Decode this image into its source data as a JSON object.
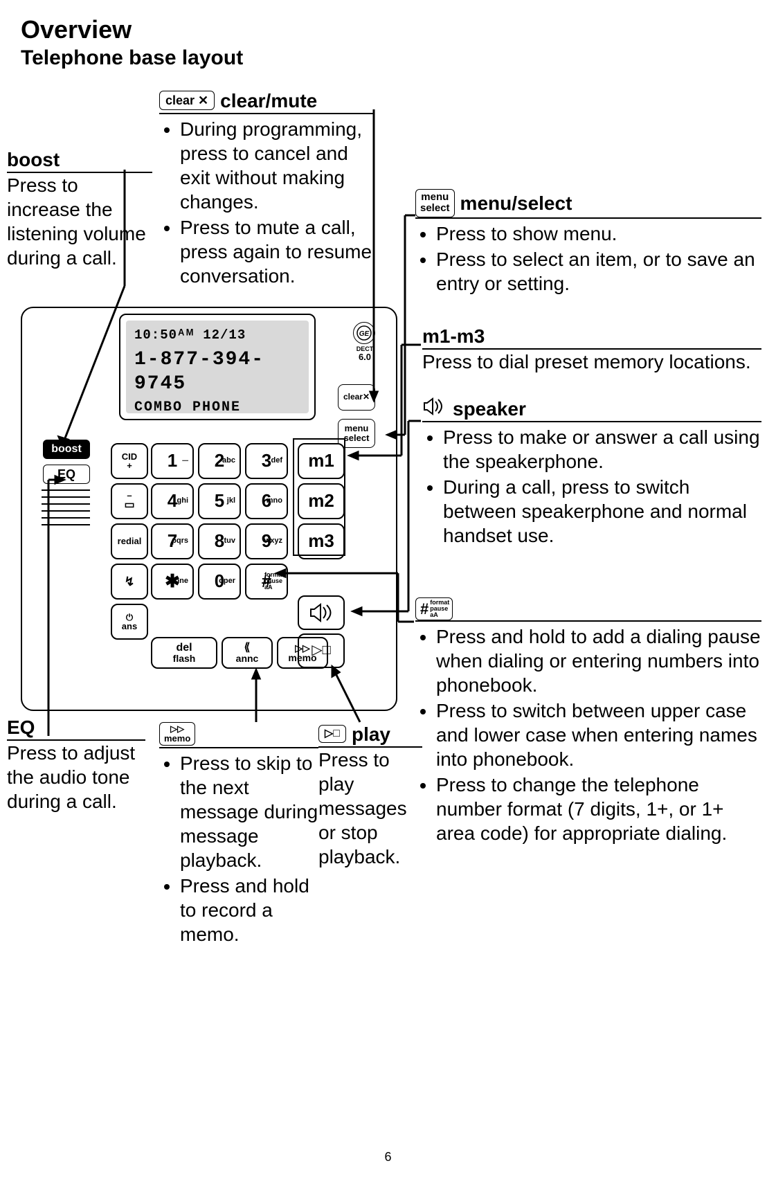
{
  "header": {
    "title": "Overview",
    "subtitle": "Telephone base layout"
  },
  "lcd": {
    "time": "10:50ᴬᴹ  12/13",
    "number": "1-877-394-9745",
    "name": "COMBO PHONE"
  },
  "buttons": {
    "boost": "boost",
    "eq": "EQ",
    "clear": "clear",
    "menu_top": "menu",
    "menu_bot": "select",
    "dect": "DECT",
    "six": "6.0",
    "m1": "m1",
    "m2": "m2",
    "m3": "m3",
    "cid_top": "CID",
    "cid_bot": "+",
    "minus": "–",
    "book": "☐",
    "redial": "redial",
    "flash": "⤴",
    "ans_top": "⏻",
    "ans_bot": "ans",
    "del_top": "del",
    "del_bot": "flash",
    "annc_top": "⟪",
    "annc_bot": "annc",
    "memo_top": "▷▷",
    "memo_bot": "memo",
    "play": "▷□"
  },
  "keys": {
    "k1": "1",
    "k2": "2",
    "k3": "3",
    "k4": "4",
    "k5": "5",
    "k6": "6",
    "k7": "7",
    "k8": "8",
    "k9": "9",
    "k0": "0",
    "ks": "✱",
    "kp": "#",
    "s1": "⏤",
    "s2": "abc",
    "s3": "def",
    "s4": "ghi",
    "s5": "jkl",
    "s6": "mno",
    "s7": "pqrs",
    "s8": "tuv",
    "s9": "wxyz",
    "s0": "oper",
    "ss": "tone",
    "sp1": "format",
    "sp2": "pause",
    "sp3": "aA"
  },
  "callouts": {
    "clear_mute": {
      "icon": "clear",
      "title": "clear/mute",
      "items": [
        "During programming, press to cancel and exit without making changes.",
        "Press to mute a call, press again to resume conversation."
      ]
    },
    "boost": {
      "title": "boost",
      "text": "Press to increase the listening volume during a call."
    },
    "menu_select": {
      "icon_top": "menu",
      "icon_bot": "select",
      "title": "menu/select",
      "items": [
        "Press to show menu.",
        "Press to select an item, or to save an entry or setting."
      ]
    },
    "m1m3": {
      "title": "m1-m3",
      "text": "Press to dial preset memory locations."
    },
    "speaker": {
      "title": "speaker",
      "items": [
        "Press to make or answer a call using the speakerphone.",
        "During a call, press to switch between speakerphone and normal handset use."
      ]
    },
    "pound": {
      "icon": "#",
      "sp1": "format",
      "sp2": "pause",
      "sp3": "aA",
      "items": [
        "Press and hold to add a dialing pause when dialing or entering numbers into phonebook.",
        "Press to switch between upper case and lower case when entering names into phonebook.",
        "Press to change the telephone number format (7 digits, 1+, or 1+ area code) for appropriate dialing."
      ]
    },
    "eq": {
      "title": "EQ",
      "text": "Press to adjust the audio tone during a call."
    },
    "memo": {
      "icon_top": "▷▷",
      "icon_bot": "memo",
      "items": [
        "Press to skip to the next message during message playback.",
        "Press and hold to record a memo."
      ]
    },
    "play": {
      "icon": "▷□",
      "title": "play",
      "text": "Press to play messages or stop playback."
    }
  },
  "page_number": "6"
}
